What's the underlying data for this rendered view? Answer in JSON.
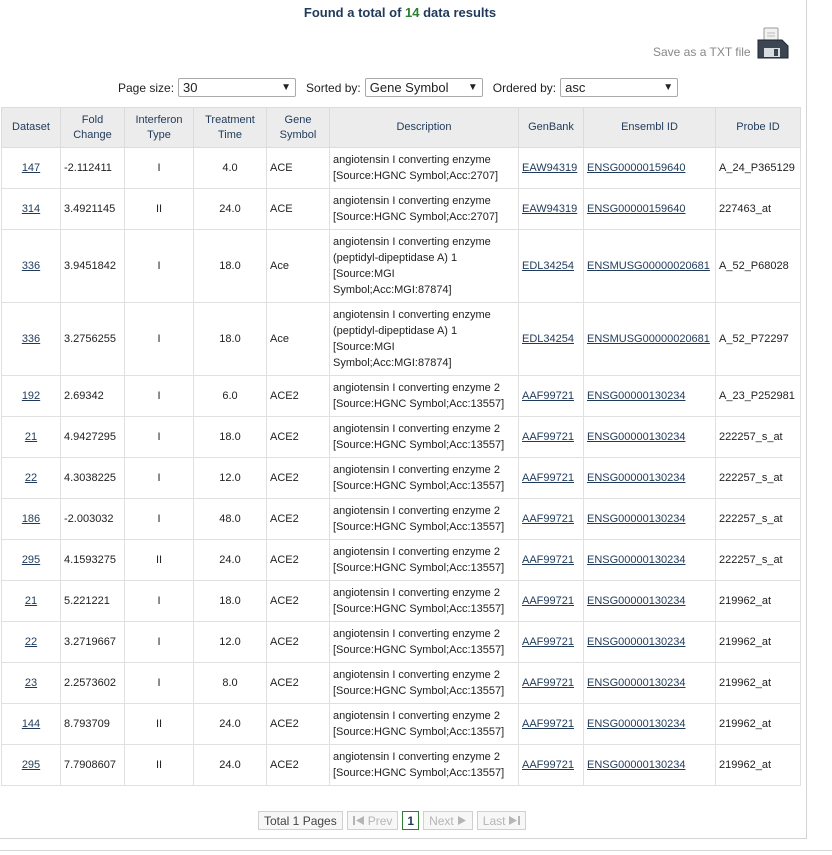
{
  "summary": {
    "prefix": "Found a total of ",
    "count": "14",
    "suffix": " data results"
  },
  "save": {
    "label": "Save as a TXT file"
  },
  "controls": {
    "page_size_label": "Page size:",
    "page_size_value": "30",
    "sorted_by_label": "Sorted by:",
    "sorted_by_value": "Gene Symbol",
    "ordered_by_label": "Ordered by:",
    "ordered_by_value": "asc"
  },
  "table": {
    "headers": [
      "Dataset",
      "Fold Change",
      "Interferon Type",
      "Treatment Time",
      "Gene Symbol",
      "Description",
      "GenBank",
      "Ensembl ID",
      "Probe ID"
    ],
    "rows": [
      {
        "dataset": "147",
        "fold": "-2.112411",
        "ifn": "I",
        "time": "4.0",
        "gene": "ACE",
        "desc": [
          "angiotensin I converting enzyme",
          "[Source:HGNC Symbol;Acc:2707]"
        ],
        "genbank": "EAW94319",
        "ensembl": "ENSG00000159640",
        "probe": "A_24_P365129"
      },
      {
        "dataset": "314",
        "fold": "3.4921145",
        "ifn": "II",
        "time": "24.0",
        "gene": "ACE",
        "desc": [
          "angiotensin I converting enzyme",
          "[Source:HGNC Symbol;Acc:2707]"
        ],
        "genbank": "EAW94319",
        "ensembl": "ENSG00000159640",
        "probe": "227463_at"
      },
      {
        "dataset": "336",
        "fold": "3.9451842",
        "ifn": "I",
        "time": "18.0",
        "gene": "Ace",
        "desc": [
          "angiotensin I converting enzyme",
          "(peptidyl-dipeptidase A) 1",
          "[Source:MGI",
          "Symbol;Acc:MGI:87874]"
        ],
        "genbank": "EDL34254",
        "ensembl": "ENSMUSG00000020681",
        "probe": "A_52_P68028"
      },
      {
        "dataset": "336",
        "fold": "3.2756255",
        "ifn": "I",
        "time": "18.0",
        "gene": "Ace",
        "desc": [
          "angiotensin I converting enzyme",
          "(peptidyl-dipeptidase A) 1",
          "[Source:MGI",
          "Symbol;Acc:MGI:87874]"
        ],
        "genbank": "EDL34254",
        "ensembl": "ENSMUSG00000020681",
        "probe": "A_52_P72297"
      },
      {
        "dataset": "192",
        "fold": "2.69342",
        "ifn": "I",
        "time": "6.0",
        "gene": "ACE2",
        "desc": [
          "angiotensin I converting enzyme 2",
          "[Source:HGNC Symbol;Acc:13557]"
        ],
        "genbank": "AAF99721",
        "ensembl": "ENSG00000130234",
        "probe": "A_23_P252981"
      },
      {
        "dataset": "21",
        "fold": "4.9427295",
        "ifn": "I",
        "time": "18.0",
        "gene": "ACE2",
        "desc": [
          "angiotensin I converting enzyme 2",
          "[Source:HGNC Symbol;Acc:13557]"
        ],
        "genbank": "AAF99721",
        "ensembl": "ENSG00000130234",
        "probe": "222257_s_at"
      },
      {
        "dataset": "22",
        "fold": "4.3038225",
        "ifn": "I",
        "time": "12.0",
        "gene": "ACE2",
        "desc": [
          "angiotensin I converting enzyme 2",
          "[Source:HGNC Symbol;Acc:13557]"
        ],
        "genbank": "AAF99721",
        "ensembl": "ENSG00000130234",
        "probe": "222257_s_at"
      },
      {
        "dataset": "186",
        "fold": "-2.003032",
        "ifn": "I",
        "time": "48.0",
        "gene": "ACE2",
        "desc": [
          "angiotensin I converting enzyme 2",
          "[Source:HGNC Symbol;Acc:13557]"
        ],
        "genbank": "AAF99721",
        "ensembl": "ENSG00000130234",
        "probe": "222257_s_at"
      },
      {
        "dataset": "295",
        "fold": "4.1593275",
        "ifn": "II",
        "time": "24.0",
        "gene": "ACE2",
        "desc": [
          "angiotensin I converting enzyme 2",
          "[Source:HGNC Symbol;Acc:13557]"
        ],
        "genbank": "AAF99721",
        "ensembl": "ENSG00000130234",
        "probe": "222257_s_at"
      },
      {
        "dataset": "21",
        "fold": "5.221221",
        "ifn": "I",
        "time": "18.0",
        "gene": "ACE2",
        "desc": [
          "angiotensin I converting enzyme 2",
          "[Source:HGNC Symbol;Acc:13557]"
        ],
        "genbank": "AAF99721",
        "ensembl": "ENSG00000130234",
        "probe": "219962_at"
      },
      {
        "dataset": "22",
        "fold": "3.2719667",
        "ifn": "I",
        "time": "12.0",
        "gene": "ACE2",
        "desc": [
          "angiotensin I converting enzyme 2",
          "[Source:HGNC Symbol;Acc:13557]"
        ],
        "genbank": "AAF99721",
        "ensembl": "ENSG00000130234",
        "probe": "219962_at"
      },
      {
        "dataset": "23",
        "fold": "2.2573602",
        "ifn": "I",
        "time": "8.0",
        "gene": "ACE2",
        "desc": [
          "angiotensin I converting enzyme 2",
          "[Source:HGNC Symbol;Acc:13557]"
        ],
        "genbank": "AAF99721",
        "ensembl": "ENSG00000130234",
        "probe": "219962_at"
      },
      {
        "dataset": "144",
        "fold": "8.793709",
        "ifn": "II",
        "time": "24.0",
        "gene": "ACE2",
        "desc": [
          "angiotensin I converting enzyme 2",
          "[Source:HGNC Symbol;Acc:13557]"
        ],
        "genbank": "AAF99721",
        "ensembl": "ENSG00000130234",
        "probe": "219962_at"
      },
      {
        "dataset": "295",
        "fold": "7.7908607",
        "ifn": "II",
        "time": "24.0",
        "gene": "ACE2",
        "desc": [
          "angiotensin I converting enzyme 2",
          "[Source:HGNC Symbol;Acc:13557]"
        ],
        "genbank": "AAF99721",
        "ensembl": "ENSG00000130234",
        "probe": "219962_at"
      }
    ]
  },
  "pager": {
    "total": "Total 1 Pages",
    "prev": "Prev",
    "current": "1",
    "next": "Next",
    "last": "Last"
  },
  "icons": {
    "save": "floppy-disk-icon",
    "prev": "first-page-icon",
    "next": "next-page-icon",
    "last": "last-page-icon"
  },
  "colors": {
    "accent": "#1f3a5a",
    "count": "#2e7d32"
  }
}
